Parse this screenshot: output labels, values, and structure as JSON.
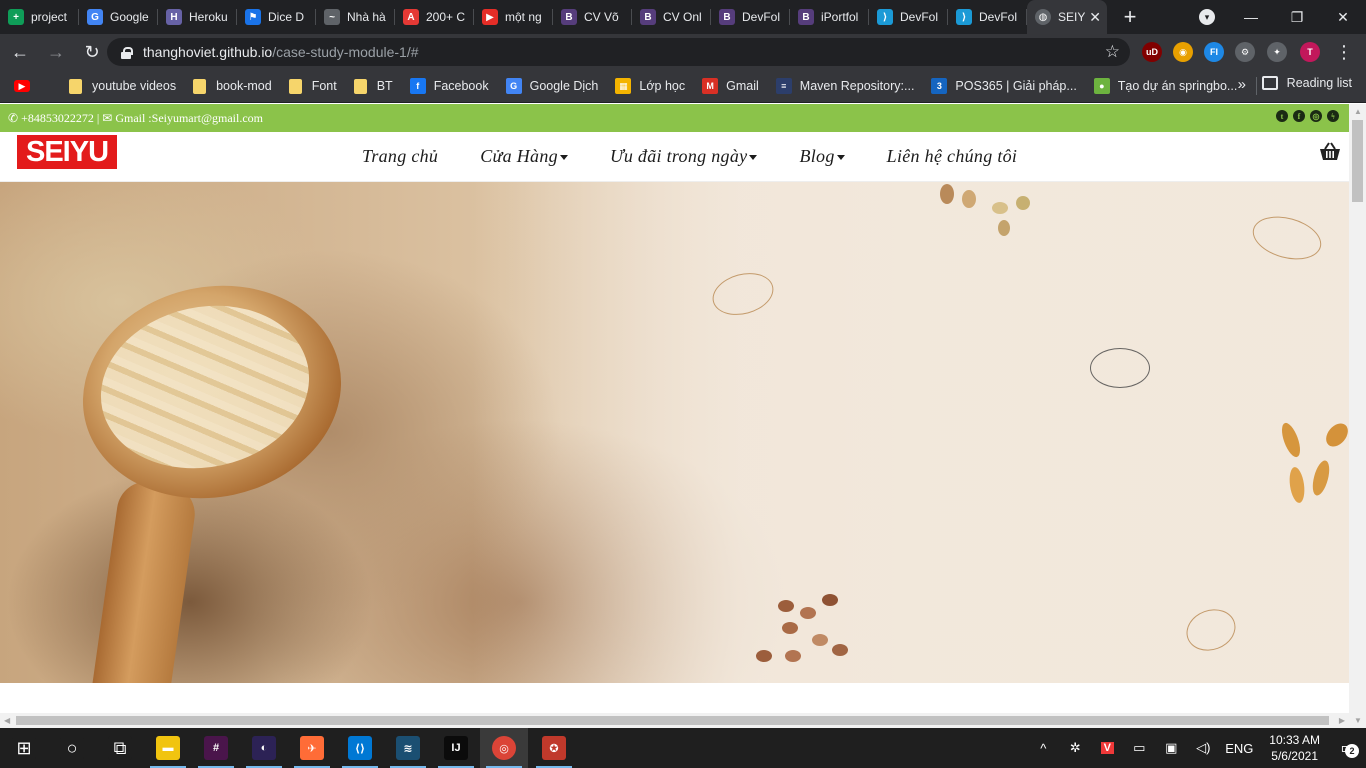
{
  "browser": {
    "tabs": [
      {
        "label": "project",
        "color": "#0f9d58",
        "glyph": "+"
      },
      {
        "label": "Google",
        "color": "#4285f4",
        "glyph": "G"
      },
      {
        "label": "Heroku",
        "color": "#6762a6",
        "glyph": "H"
      },
      {
        "label": "Dice D",
        "color": "#1a73e8",
        "glyph": "⚑"
      },
      {
        "label": "Nhà hà",
        "color": "#5f6368",
        "glyph": "~"
      },
      {
        "label": "200+ C",
        "color": "#e53935",
        "glyph": "A"
      },
      {
        "label": "một ng",
        "color": "#e52d27",
        "glyph": "▶"
      },
      {
        "label": "CV Võ",
        "color": "#563d7c",
        "glyph": "B"
      },
      {
        "label": "CV Onl",
        "color": "#563d7c",
        "glyph": "B"
      },
      {
        "label": "DevFol",
        "color": "#563d7c",
        "glyph": "B"
      },
      {
        "label": "iPortfol",
        "color": "#563d7c",
        "glyph": "B"
      },
      {
        "label": "DevFol",
        "color": "#1b9ad6",
        "glyph": "⟩"
      },
      {
        "label": "DevFol",
        "color": "#1b9ad6",
        "glyph": "⟩"
      }
    ],
    "active_tab": {
      "label": "SEIY",
      "close": "✕"
    },
    "new_tab": "+",
    "window_controls": [
      "—",
      "❐",
      "✕"
    ],
    "address": {
      "host": "thanghoviet.github.io",
      "path": "/case-study-module-1/#"
    },
    "extensions": [
      {
        "name": "ublock-icon",
        "glyph": "uD",
        "color": "#800000"
      },
      {
        "name": "extension-color-icon",
        "glyph": "◉",
        "color": "#e8a000"
      },
      {
        "name": "fi-extension-icon",
        "glyph": "FI",
        "color": "#1e88e5"
      },
      {
        "name": "gear-extension-icon",
        "glyph": "⚙",
        "color": "#5f6368"
      },
      {
        "name": "puzzle-icon",
        "glyph": "✦",
        "color": "#5f6368"
      },
      {
        "name": "profile-avatar",
        "glyph": "T",
        "color": "#c2185b"
      }
    ],
    "bookmarks": [
      {
        "label": "",
        "type": "youtube"
      },
      {
        "label": "youtube videos",
        "type": "folder"
      },
      {
        "label": "book-mod",
        "type": "folder"
      },
      {
        "label": "Font",
        "type": "folder"
      },
      {
        "label": "BT",
        "type": "folder"
      },
      {
        "label": "Facebook",
        "type": "icon",
        "color": "#1877f2",
        "glyph": "f"
      },
      {
        "label": "Google Dịch",
        "type": "icon",
        "color": "#4285f4",
        "glyph": "G"
      },
      {
        "label": "Lớp học",
        "type": "icon",
        "color": "#f4b400",
        "glyph": "▦"
      },
      {
        "label": "Gmail",
        "type": "icon",
        "color": "#d93025",
        "glyph": "M"
      },
      {
        "label": "Maven Repository:...",
        "type": "icon",
        "color": "#2c3e6b",
        "glyph": "≡"
      },
      {
        "label": "POS365 | Giải pháp...",
        "type": "icon",
        "color": "#1565c0",
        "glyph": "3"
      },
      {
        "label": "Tạo dự án springbo...",
        "type": "icon",
        "color": "#6db33f",
        "glyph": "●"
      }
    ],
    "bookmarks_more": "»",
    "reading_list": "Reading list"
  },
  "site": {
    "contact": {
      "phone": "+84853022272",
      "separator": "|",
      "email_label": "Gmail :Seiyumart@gmail.com"
    },
    "socials": [
      "twitter-icon",
      "facebook-icon",
      "instagram-icon",
      "messenger-icon"
    ],
    "logo": "SEIYU",
    "menu": [
      {
        "label": "Trang chủ",
        "caret": false
      },
      {
        "label": "Cửa Hàng",
        "caret": true
      },
      {
        "label": "Ưu đãi trong ngày",
        "caret": true
      },
      {
        "label": "Blog",
        "caret": true
      },
      {
        "label": "Liên hệ chúng tôi",
        "caret": false
      }
    ]
  },
  "taskbar": {
    "apps": [
      {
        "name": "windows-start-icon",
        "glyph": "⊞",
        "color": "#1f1f1f"
      },
      {
        "name": "cortana-search-icon",
        "glyph": "○",
        "color": "#1f1f1f"
      },
      {
        "name": "task-view-icon",
        "glyph": "⧉",
        "color": "#1f1f1f"
      },
      {
        "name": "file-explorer-icon",
        "glyph": "▬",
        "color": "#f1c40f"
      },
      {
        "name": "slack-icon",
        "glyph": "#",
        "color": "#4a154b"
      },
      {
        "name": "eclipse-icon",
        "glyph": "◐",
        "color": "#2c2255"
      },
      {
        "name": "postman-icon",
        "glyph": "✈",
        "color": "#ff6c37"
      },
      {
        "name": "vscode-icon",
        "glyph": "⟨⟩",
        "color": "#0078d4"
      },
      {
        "name": "mysql-workbench-icon",
        "glyph": "≋",
        "color": "#1b4f72"
      },
      {
        "name": "intellij-icon",
        "glyph": "IJ",
        "color": "#0b0b0b"
      },
      {
        "name": "chrome-icon",
        "glyph": "◎",
        "color": "#db4437"
      },
      {
        "name": "garena-icon",
        "glyph": "✪",
        "color": "#c0392b"
      }
    ],
    "tray": {
      "chevron": "^",
      "language": "ENG",
      "time": "10:33 AM",
      "date": "5/6/2021",
      "notifications": "2"
    }
  }
}
